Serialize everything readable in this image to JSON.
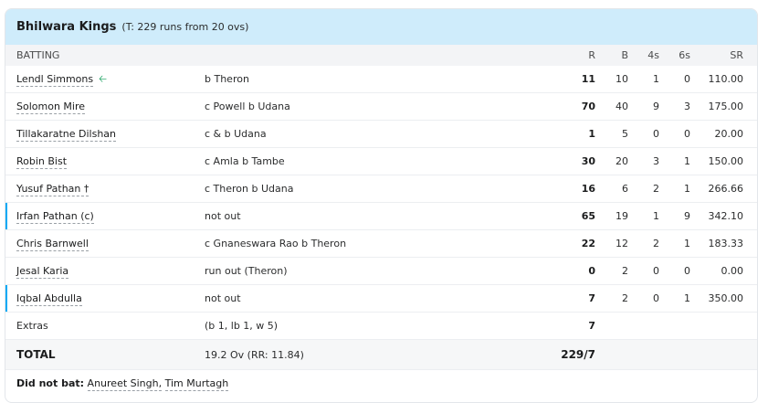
{
  "header": {
    "team": "Bhilwara Kings",
    "target": "(T: 229 runs from 20 ovs)"
  },
  "columns": {
    "batting": "BATTING",
    "r": "R",
    "b": "B",
    "fours": "4s",
    "sixes": "6s",
    "sr": "SR"
  },
  "batters": [
    {
      "name": "Lendl Simmons",
      "dismissal": "b Theron",
      "r": "11",
      "b": "10",
      "fours": "1",
      "sixes": "0",
      "sr": "110.00"
    },
    {
      "name": "Solomon Mire",
      "dismissal": "c Powell b Udana",
      "r": "70",
      "b": "40",
      "fours": "9",
      "sixes": "3",
      "sr": "175.00"
    },
    {
      "name": "Tillakaratne Dilshan",
      "dismissal": "c & b Udana",
      "r": "1",
      "b": "5",
      "fours": "0",
      "sixes": "0",
      "sr": "20.00"
    },
    {
      "name": "Robin Bist",
      "dismissal": "c Amla b Tambe",
      "r": "30",
      "b": "20",
      "fours": "3",
      "sixes": "1",
      "sr": "150.00"
    },
    {
      "name": "Yusuf Pathan †",
      "dismissal": "c Theron b Udana",
      "r": "16",
      "b": "6",
      "fours": "2",
      "sixes": "1",
      "sr": "266.66"
    },
    {
      "name": "Irfan Pathan (c)",
      "dismissal": "not out",
      "r": "65",
      "b": "19",
      "fours": "1",
      "sixes": "9",
      "sr": "342.10"
    },
    {
      "name": "Chris Barnwell",
      "dismissal": "c Gnaneswara Rao b Theron",
      "r": "22",
      "b": "12",
      "fours": "2",
      "sixes": "1",
      "sr": "183.33"
    },
    {
      "name": "Jesal Karia",
      "dismissal": "run out (Theron)",
      "r": "0",
      "b": "2",
      "fours": "0",
      "sixes": "0",
      "sr": "0.00"
    },
    {
      "name": "Iqbal Abdulla",
      "dismissal": "not out",
      "r": "7",
      "b": "2",
      "fours": "0",
      "sixes": "1",
      "sr": "350.00"
    }
  ],
  "extras": {
    "label": "Extras",
    "detail": "(b 1, lb 1, w 5)",
    "value": "7"
  },
  "total": {
    "label": "TOTAL",
    "overs": "19.2 Ov (RR: 11.84)",
    "score": "229/7"
  },
  "did_not_bat": {
    "label": "Did not bat:",
    "players": [
      "Anureet Singh,",
      "Tim Murtagh"
    ]
  },
  "icons": {
    "dismissed_marker": "arrow-left-icon",
    "not_out_marker_color": "#03a9f4",
    "header_bg": "#cfecfb"
  }
}
